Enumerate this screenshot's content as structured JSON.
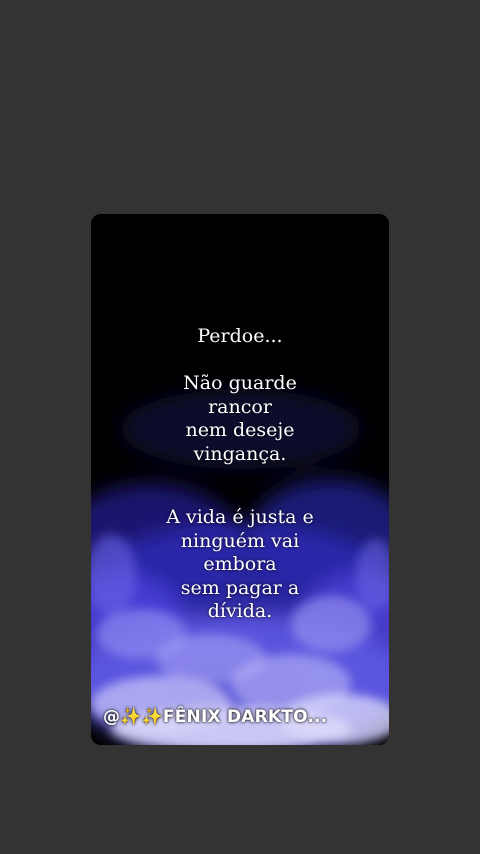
{
  "quote": {
    "title": "Perdoe...",
    "para1": [
      "Não guarde",
      "rancor",
      "nem deseje",
      "vingança."
    ],
    "para2": [
      "A vida é justa e",
      "ninguém vai",
      "embora",
      "sem pagar a",
      "dívida."
    ]
  },
  "watermark": {
    "text": "@✨✨FÊNIX DARKTO..."
  },
  "colors": {
    "page_background": "#343232",
    "card_background": "#000000",
    "smoke": "#4b3fd6",
    "text": "#ffffff"
  }
}
